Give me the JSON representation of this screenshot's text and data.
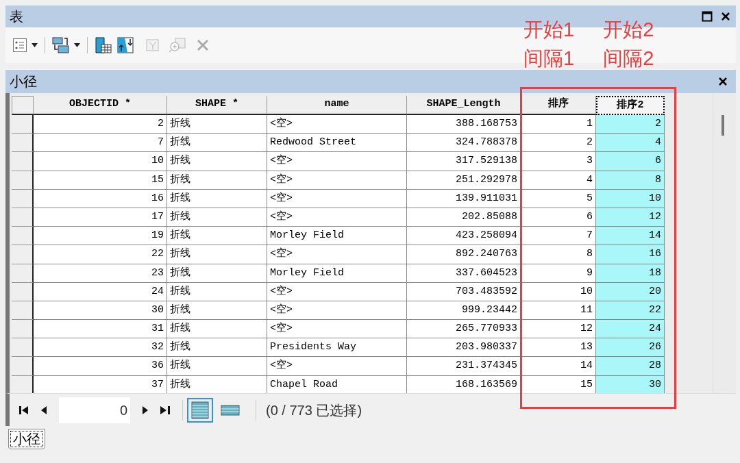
{
  "window": {
    "title": "表"
  },
  "table_title": "小径",
  "columns": [
    {
      "label": "OBJECTID *",
      "kind": "number",
      "selected": false
    },
    {
      "label": "SHAPE *",
      "kind": "text",
      "selected": false
    },
    {
      "label": "name",
      "kind": "text",
      "selected": false
    },
    {
      "label": "SHAPE_Length",
      "kind": "number",
      "selected": false
    },
    {
      "label": "排序",
      "kind": "number",
      "selected": false
    },
    {
      "label": "排序2",
      "kind": "number",
      "selected": true
    }
  ],
  "rows": [
    [
      "2",
      "折线",
      "<空>",
      "388.168753",
      "1",
      "2"
    ],
    [
      "7",
      "折线",
      "Redwood Street",
      "324.788378",
      "2",
      "4"
    ],
    [
      "10",
      "折线",
      "<空>",
      "317.529138",
      "3",
      "6"
    ],
    [
      "15",
      "折线",
      "<空>",
      "251.292978",
      "4",
      "8"
    ],
    [
      "16",
      "折线",
      "<空>",
      "139.911031",
      "5",
      "10"
    ],
    [
      "17",
      "折线",
      "<空>",
      "202.85088",
      "6",
      "12"
    ],
    [
      "19",
      "折线",
      "Morley Field",
      "423.258094",
      "7",
      "14"
    ],
    [
      "22",
      "折线",
      "<空>",
      "892.240763",
      "8",
      "16"
    ],
    [
      "23",
      "折线",
      "Morley Field",
      "337.604523",
      "9",
      "18"
    ],
    [
      "24",
      "折线",
      "<空>",
      "703.483592",
      "10",
      "20"
    ],
    [
      "30",
      "折线",
      "<空>",
      "999.23442",
      "11",
      "22"
    ],
    [
      "31",
      "折线",
      "<空>",
      "265.770933",
      "12",
      "24"
    ],
    [
      "32",
      "折线",
      "Presidents Way",
      "203.980337",
      "13",
      "26"
    ],
    [
      "36",
      "折线",
      "<空>",
      "231.374345",
      "14",
      "28"
    ],
    [
      "37",
      "折线",
      "Chapel Road",
      "168.163569",
      "15",
      "30"
    ]
  ],
  "navigator": {
    "record": "0",
    "selection": "(0 / 773 已选择)",
    "views": [
      {
        "kind": "all",
        "selected": true
      },
      {
        "kind": "selected",
        "selected": false
      }
    ]
  },
  "tabs": [
    {
      "label": "小径",
      "selected": true
    }
  ],
  "annotations": [
    {
      "lines": [
        "开始1",
        "间隔1"
      ]
    },
    {
      "lines": [
        "开始2",
        "间隔2"
      ]
    }
  ]
}
